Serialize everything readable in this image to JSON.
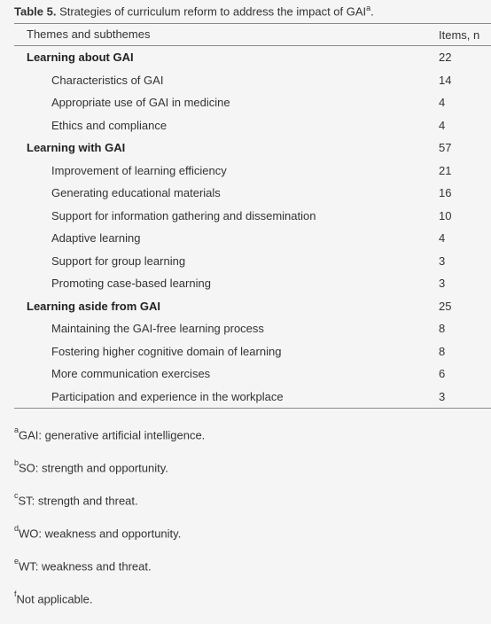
{
  "caption": {
    "label": "Table 5.",
    "text": " Strategies of curriculum reform to address the impact of GAI",
    "sup": "a",
    "end": "."
  },
  "header": {
    "theme": "Themes and subthemes",
    "items": "Items, n"
  },
  "rows": [
    {
      "label": "Learning about GAI",
      "value": "22",
      "level": 0
    },
    {
      "label": "Characteristics of GAI",
      "value": "14",
      "level": 1
    },
    {
      "label": "Appropriate use of GAI in medicine",
      "value": "4",
      "level": 1
    },
    {
      "label": "Ethics and compliance",
      "value": "4",
      "level": 1
    },
    {
      "label": "Learning with GAI",
      "value": "57",
      "level": 0
    },
    {
      "label": "Improvement of learning efficiency",
      "value": "21",
      "level": 1
    },
    {
      "label": "Generating educational materials",
      "value": "16",
      "level": 1
    },
    {
      "label": "Support for information gathering and dissemination",
      "value": "10",
      "level": 1
    },
    {
      "label": "Adaptive learning",
      "value": "4",
      "level": 1
    },
    {
      "label": "Support for group learning",
      "value": "3",
      "level": 1
    },
    {
      "label": "Promoting case-based learning",
      "value": "3",
      "level": 1
    },
    {
      "label": "Learning aside from GAI",
      "value": "25",
      "level": 0
    },
    {
      "label": "Maintaining the GAI-free learning process",
      "value": "8",
      "level": 1
    },
    {
      "label": "Fostering higher cognitive domain of learning",
      "value": "8",
      "level": 1
    },
    {
      "label": "More communication exercises",
      "value": "6",
      "level": 1
    },
    {
      "label": "Participation and experience in the workplace",
      "value": "3",
      "level": 1
    }
  ],
  "footnotes": [
    {
      "sup": "a",
      "text": "GAI: generative artificial intelligence."
    },
    {
      "sup": "b",
      "text": "SO: strength and opportunity."
    },
    {
      "sup": "c",
      "text": "ST: strength and threat."
    },
    {
      "sup": "d",
      "text": "WO: weakness and opportunity."
    },
    {
      "sup": "e",
      "text": "WT: weakness and threat."
    },
    {
      "sup": "f",
      "text": "Not applicable."
    }
  ]
}
